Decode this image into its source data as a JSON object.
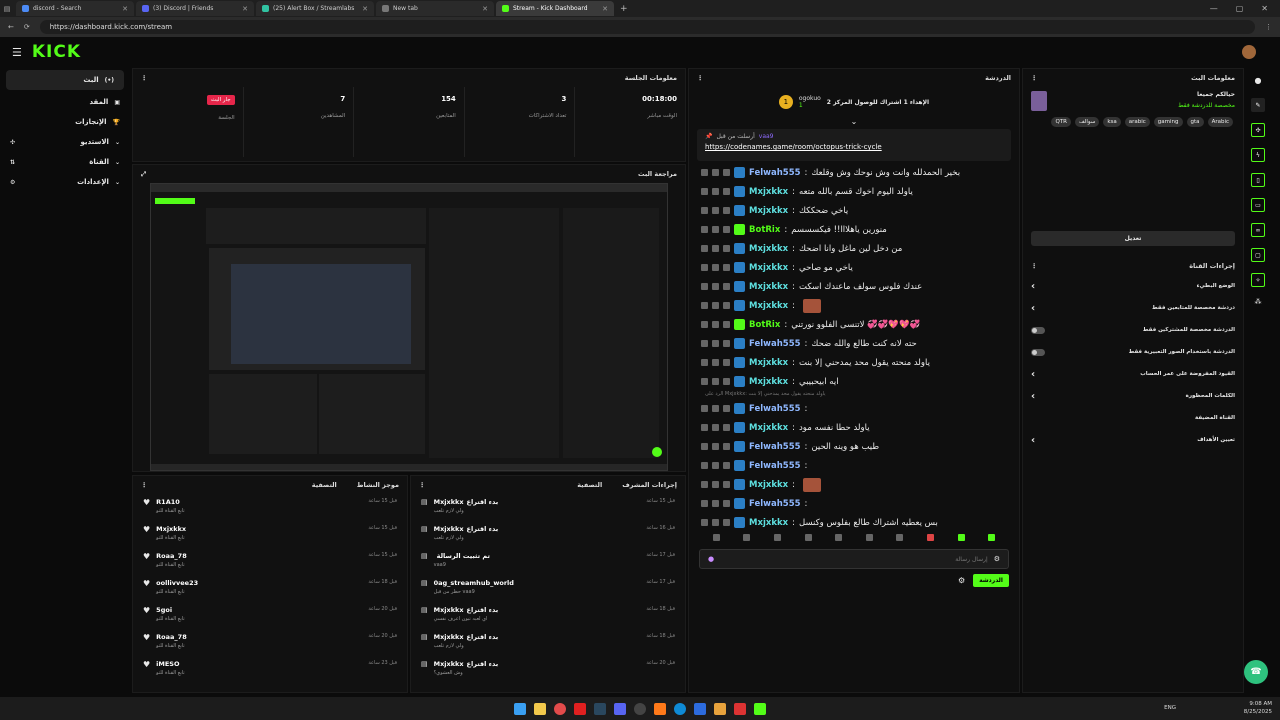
{
  "browser": {
    "tabs": [
      {
        "title": "discord - Search",
        "color": "#4c8bf5"
      },
      {
        "title": "(3) Discord | Friends",
        "color": "#5865f2"
      },
      {
        "title": "(25) Alert Box / Streamlabs",
        "color": "#31c3a2"
      },
      {
        "title": "New tab",
        "color": "#777"
      },
      {
        "title": "Stream - Kick Dashboard",
        "color": "#53fc18"
      }
    ],
    "url": "https://dashboard.kick.com/stream"
  },
  "brand": {
    "logo": "KICK",
    "accent": "#53fc18"
  },
  "sidebar": {
    "items": [
      {
        "label": "البث"
      },
      {
        "label": "المقد"
      },
      {
        "label": "الإنجازات"
      },
      {
        "label": "الاستديو"
      },
      {
        "label": "القناة"
      },
      {
        "label": "الإعدادات"
      }
    ]
  },
  "session": {
    "title": "معلومات الجلسة",
    "live_label": "جار البث",
    "session_label": "الجلسة",
    "stats": [
      {
        "value": "00:18:00",
        "label": "الوقت مباشر"
      },
      {
        "value": "3",
        "label": "تعداد الاشتراكات"
      },
      {
        "value": "154",
        "label": "المتابعين"
      },
      {
        "value": "7",
        "label": "المشاهدين"
      }
    ]
  },
  "preview": {
    "title": "مراجعة البث"
  },
  "activity": {
    "title": "موجز النشاط",
    "filter": "التصفية",
    "items": [
      {
        "name": "R1A10",
        "sub": "تابع القناة للتو",
        "time": "قبل 15 ساعة"
      },
      {
        "name": "Mxjxkkx",
        "sub": "تابع القناة للتو",
        "time": "قبل 15 ساعة"
      },
      {
        "name": "Roaa_78",
        "sub": "تابع القناة للتو",
        "time": "قبل 15 ساعة"
      },
      {
        "name": "oollivvee23",
        "sub": "تابع القناة للتو",
        "time": "قبل 18 ساعة"
      },
      {
        "name": "5goi",
        "sub": "تابع القناة للتو",
        "time": "قبل 20 ساعة"
      },
      {
        "name": "Roaa_78",
        "sub": "تابع القناة للتو",
        "time": "قبل 20 ساعة"
      },
      {
        "name": "iMESO",
        "sub": "تابع القناة للتو",
        "time": "قبل 23 ساعة"
      }
    ]
  },
  "modactions": {
    "title": "إجراءات المشرف",
    "filter": "التصفية",
    "items": [
      {
        "name": "Mxjxkkx",
        "action": "بدء اقتراع",
        "sub": "ولي لازم تلعب",
        "time": "قبل 15 ساعة"
      },
      {
        "name": "Mxjxkkx",
        "action": "بدء اقتراع",
        "sub": "ولي لازم تلعب",
        "time": "قبل 16 ساعة"
      },
      {
        "name": "",
        "action": "تم تثبيت الرسالة",
        "sub": "vaa9",
        "time": "قبل 17 ساعة"
      },
      {
        "name": "0ag_streamhub_world",
        "action": "",
        "sub": "حظر من قبل vaa9",
        "time": "قبل 17 ساعة"
      },
      {
        "name": "Mxjxkkx",
        "action": "بدء اقتراع",
        "sub": "اي لعبه تبون اعرف نفسي",
        "time": "قبل 18 ساعة"
      },
      {
        "name": "Mxjxkkx",
        "action": "بدء اقتراع",
        "sub": "ولي لازم تلعب",
        "time": "قبل 18 ساعة"
      },
      {
        "name": "Mxjxkkx",
        "action": "بدء اقتراع",
        "sub": "وش العشوي؟",
        "time": "قبل 20 ساعة"
      }
    ]
  },
  "chat": {
    "title": "الدردشة",
    "goal": {
      "name": "ogokuo",
      "count": "1",
      "text": "الإهداء 1 اشتراك للوصول المركز 2"
    },
    "pinned": {
      "by": "vaa9",
      "label": "أرسلت من قبل",
      "link": "https://codenames.game/room/octopus-trick-cycle"
    },
    "messages": [
      {
        "user": "Felwah555",
        "color": "#8fb8ff",
        "text": "بخير الحمدلله وانت وش نوحك وش وقلعك"
      },
      {
        "user": "Mxjxkkx",
        "color": "#5ee0e0",
        "text": "ياولد اليوم اخوك قسم بالله متعه"
      },
      {
        "user": "Mxjxkkx",
        "color": "#5ee0e0",
        "text": "ياخي ضحككك"
      },
      {
        "user": "BotRix",
        "color": "#53fc18",
        "text": "منورين ياهلااا!! فيكسسسم"
      },
      {
        "user": "Mxjxkkx",
        "color": "#5ee0e0",
        "text": "من دخل لين ماغل وانا اضحك"
      },
      {
        "user": "Mxjxkkx",
        "color": "#5ee0e0",
        "text": "ياخي مو صاحي"
      },
      {
        "user": "Mxjxkkx",
        "color": "#5ee0e0",
        "text": "عندك فلوس سولف ماعندك اسكت"
      },
      {
        "user": "Mxjxkkx",
        "color": "#5ee0e0",
        "text": ""
      },
      {
        "user": "BotRix",
        "color": "#53fc18",
        "text": "لاتنسى الفلوو نورتني 💞💞💖💖💞"
      },
      {
        "user": "Felwah555",
        "color": "#8fb8ff",
        "text": "حته لانه كنت طالع والله ضحك"
      },
      {
        "user": "Mxjxkkx",
        "color": "#5ee0e0",
        "text": "ياولد منحته يقول محد يمدحني إلا بنت"
      },
      {
        "user": "Mxjxkkx",
        "color": "#5ee0e0",
        "text": "ايه ابيحبيبي"
      }
    ],
    "reply_hint": "الرد على Mxjxkkx: ياولد منحته يقول محد يمدحني إلا بنت",
    "messages2": [
      {
        "user": "Felwah555",
        "color": "#8fb8ff",
        "text": ""
      },
      {
        "user": "Mxjxkkx",
        "color": "#5ee0e0",
        "text": "ياولد حطا نفسه مود"
      },
      {
        "user": "Felwah555",
        "color": "#8fb8ff",
        "text": "طيب هو وينه الحين"
      },
      {
        "user": "Felwah555",
        "color": "#8fb8ff",
        "text": ""
      },
      {
        "user": "Mxjxkkx",
        "color": "#5ee0e0",
        "text": ""
      },
      {
        "user": "Felwah555",
        "color": "#8fb8ff",
        "text": ""
      },
      {
        "user": "Mxjxkkx",
        "color": "#5ee0e0",
        "text": "بس يعطيه اشتراك طالع بفلوس وكنسل"
      }
    ],
    "input_placeholder": "إرسال رسالة",
    "send_label": "الدردشة"
  },
  "streaminfo": {
    "title": "معلومات البث",
    "stream_title": "حيالكم جميعا",
    "category": "مخصصة للدردشة فقط",
    "tags": [
      "QTR",
      "سوالف",
      "ksa",
      "arabic",
      "gaming",
      "gta",
      "Arabic"
    ],
    "edit_label": "تعديل"
  },
  "channelactions": {
    "title": "إجراءات القناة",
    "rows": [
      {
        "label": "الوضع البطيء",
        "kind": "chevron"
      },
      {
        "label": "دردشة مخصصة للمتابعين فقط",
        "kind": "chevron"
      },
      {
        "label": "الدردشة مخصصة للمشتركين فقط",
        "kind": "toggle"
      },
      {
        "label": "الدردشة باستخدام الصور التعبيرية فقط",
        "kind": "toggle"
      },
      {
        "label": "القيود المفروضة على عمر الحساب",
        "kind": "chevron"
      },
      {
        "label": "الكلمات المحظورة",
        "kind": "chevron"
      },
      {
        "label": "القناة المضيفة",
        "kind": "none"
      },
      {
        "label": "تعيين الأهداف",
        "kind": "chevron"
      }
    ]
  },
  "taskbar": {
    "lang": "ENG",
    "time": "9:08 AM",
    "date": "8/25/2025"
  }
}
